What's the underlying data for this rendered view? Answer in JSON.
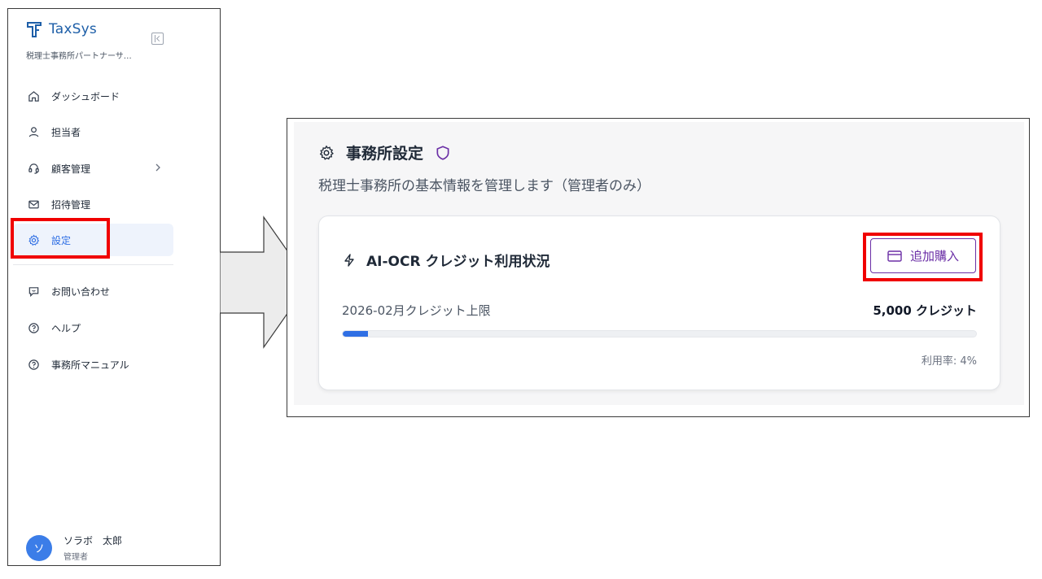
{
  "sidebar": {
    "logo_text": "TaxSys",
    "org_name": "税理士事務所パートナーサ…",
    "nav": [
      {
        "label": "ダッシュボード",
        "icon": "home-icon"
      },
      {
        "label": "担当者",
        "icon": "user-icon"
      },
      {
        "label": "顧客管理",
        "icon": "headset-icon",
        "has_submenu": true
      },
      {
        "label": "招待管理",
        "icon": "mail-icon"
      },
      {
        "label": "設定",
        "icon": "gear-icon",
        "active": true
      }
    ],
    "secondary_nav": [
      {
        "label": "お問い合わせ",
        "icon": "chat-icon"
      },
      {
        "label": "ヘルプ",
        "icon": "help-circle-icon"
      },
      {
        "label": "事務所マニュアル",
        "icon": "help-circle-icon"
      }
    ],
    "user": {
      "initial": "ソ",
      "name": "ソラボ　太郎",
      "role": "管理者"
    }
  },
  "settings": {
    "title": "事務所設定",
    "subtitle": "税理士事務所の基本情報を管理します（管理者のみ）",
    "card": {
      "title": "AI-OCR クレジット利用状況",
      "buy_label": "追加購入",
      "limit_label": "2026-02月クレジット上限",
      "limit_value": "5,000 クレジット",
      "usage_rate_text": "利用率: 4%",
      "usage_fraction": 0.04
    }
  },
  "colors": {
    "accent_blue": "#2f6fe4",
    "brand_blue": "#1e5fa8",
    "buy_purple": "#6b2fa6",
    "highlight_red": "#f00000",
    "active_nav_bg": "#eef3fc"
  }
}
